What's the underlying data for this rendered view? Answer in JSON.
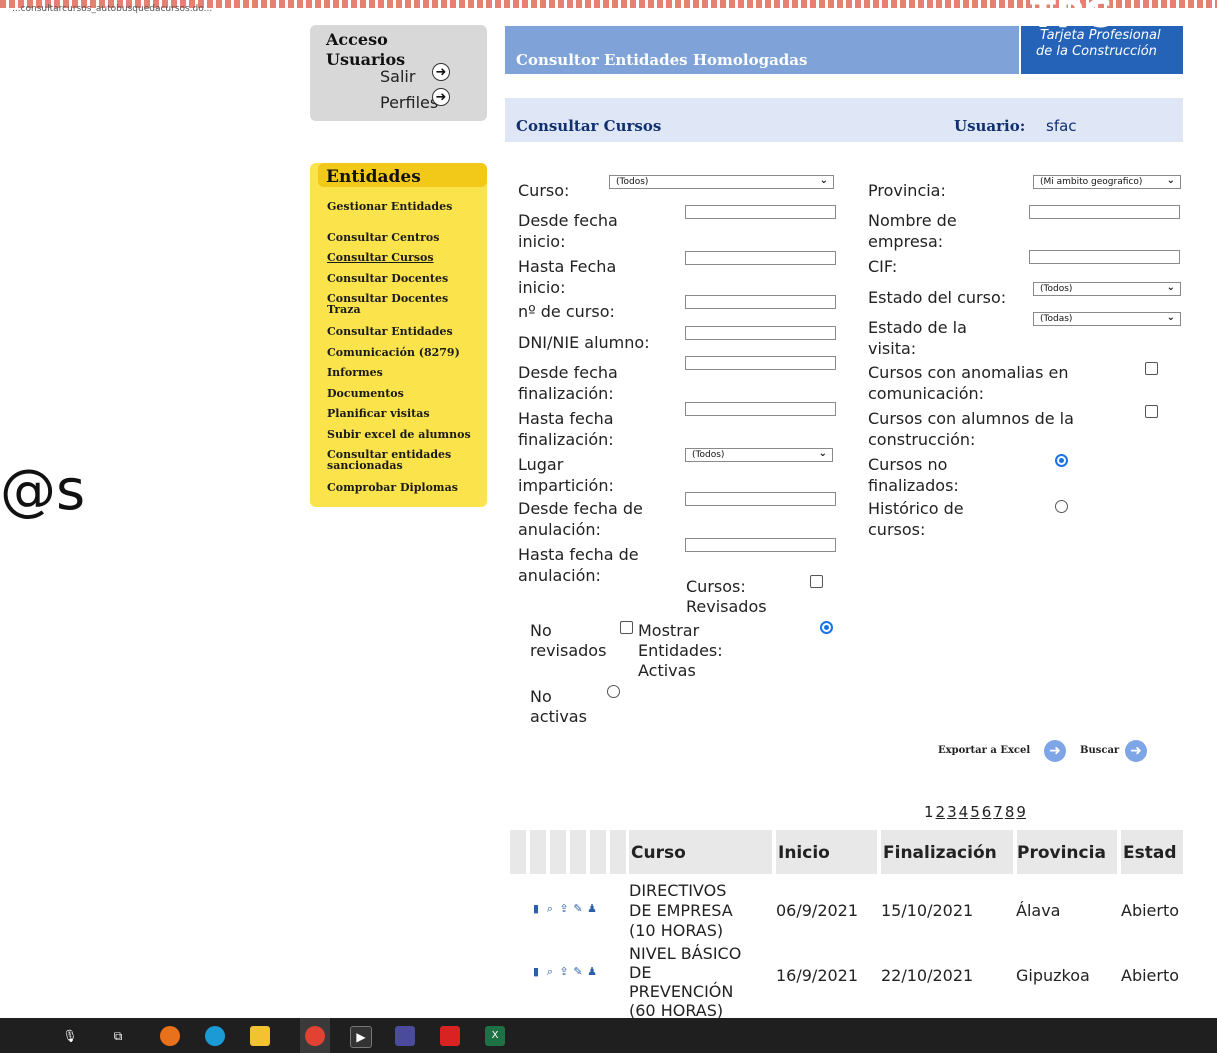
{
  "browser": {
    "url_fragment": "...consultarcursos_autobusquedacursos.do..."
  },
  "side_text": "@s",
  "access": {
    "title": "Acceso",
    "users_title": "Usuarios",
    "links": [
      {
        "label": "Salir",
        "icon": "arrow-right-circle-icon"
      },
      {
        "label": "Perfiles",
        "icon": "arrow-right-circle-icon"
      }
    ]
  },
  "entities_menu": {
    "title": "Entidades",
    "items": [
      {
        "label": "Gestionar Entidades"
      },
      {
        "label": "Consultar Centros"
      },
      {
        "label": "Consultar Cursos",
        "active": true
      },
      {
        "label": "Consultar Docentes"
      },
      {
        "label": "Consultar Docentes Traza"
      },
      {
        "label": "Consultar Entidades"
      },
      {
        "label": "Comunicación (8279)"
      },
      {
        "label": "Informes"
      },
      {
        "label": "Documentos"
      },
      {
        "label": "Planificar visitas"
      },
      {
        "label": "Subir excel de alumnos"
      },
      {
        "label": "Consultar entidades sancionadas"
      },
      {
        "label": "Comprobar Diplomas"
      }
    ]
  },
  "header": {
    "title": "Consultor Entidades Homologadas",
    "logo": {
      "big": "TPC",
      "line1": "Tarjeta Profesional",
      "line2": "de la Construcción"
    }
  },
  "subheader": {
    "title": "Consultar Cursos",
    "user_label": "Usuario:",
    "user_value": "sfac"
  },
  "form": {
    "curso": {
      "label": "Curso:",
      "value": "(Todos)"
    },
    "desde_fecha_inicio": {
      "label1": "Desde fecha",
      "label2": "inicio:",
      "value": ""
    },
    "hasta_fecha_inicio": {
      "label1": "Hasta Fecha",
      "label2": "inicio:",
      "value": ""
    },
    "num_curso": {
      "label": "nº de curso:",
      "value": ""
    },
    "dni": {
      "label": "DNI/NIE alumno:",
      "value": ""
    },
    "desde_fecha_fin": {
      "label1": "Desde fecha",
      "label2": "finalización:",
      "value": ""
    },
    "hasta_fecha_fin": {
      "label1": "Hasta fecha",
      "label2": "finalización:",
      "value": ""
    },
    "lugar": {
      "label1": "Lugar",
      "label2": "impartición:",
      "value": "(Todos)"
    },
    "desde_anul": {
      "label1": "Desde fecha de",
      "label2": "anulación:",
      "value": ""
    },
    "hasta_anul": {
      "label1": "Hasta fecha de",
      "label2": "anulación:",
      "value": ""
    },
    "revisados": {
      "label1": "Cursos:",
      "label2": "Revisados",
      "checked": false
    },
    "no_revisados": {
      "label1": "No",
      "label2": "revisados",
      "checked": false
    },
    "mostrar": {
      "label1": "Mostrar",
      "label2": "Entidades:",
      "label3": "Activas",
      "checked": true
    },
    "no_activas": {
      "label1": "No",
      "label2": "activas",
      "checked": false
    },
    "provincia": {
      "label": "Provincia:",
      "value": "(Mi ambito geografico)"
    },
    "nombre_empresa": {
      "label1": "Nombre de",
      "label2": "empresa:",
      "value": ""
    },
    "cif": {
      "label": "CIF:",
      "value": ""
    },
    "estado_curso": {
      "label": "Estado del curso:",
      "value": "(Todos)"
    },
    "estado_visita": {
      "label1": "Estado de la",
      "label2": "visita:",
      "value": "(Todas)"
    },
    "anomalias": {
      "label1": "Cursos con anomalias en",
      "label2": "comunicación:",
      "checked": false
    },
    "alumnos_construccion": {
      "label1": "Cursos con alumnos de la",
      "label2": "construcción:",
      "checked": false
    },
    "no_finalizados": {
      "label1": "Cursos no",
      "label2": "finalizados:",
      "checked": true
    },
    "historico": {
      "label1": "Histórico de",
      "label2": "cursos:",
      "checked": false
    }
  },
  "actions": {
    "export_label": "Exportar a Excel",
    "search_label": "Buscar"
  },
  "pagination": {
    "pages": [
      "1",
      "2",
      "3",
      "4",
      "5",
      "6",
      "7",
      "8",
      "9"
    ],
    "current": "1"
  },
  "table": {
    "headers": [
      "Curso",
      "Inicio",
      "Finalización",
      "Provincia",
      "Estad"
    ],
    "rows": [
      {
        "curso_lines": [
          "DIRECTIVOS",
          "DE EMPRESA",
          "(10 HORAS)"
        ],
        "inicio": "06/9/2021",
        "fin": "15/10/2021",
        "provincia": "Álava",
        "estado": "Abierto"
      },
      {
        "curso_lines": [
          "NIVEL BÁSICO",
          "DE",
          "PREVENCIÓN",
          "(60 HORAS)"
        ],
        "inicio": "16/9/2021",
        "fin": "22/10/2021",
        "provincia": "Gipuzkoa",
        "estado": "Abierto"
      }
    ]
  },
  "taskbar": {
    "icons": [
      "microphone-icon",
      "task-view-icon",
      "firefox-icon",
      "edge-icon",
      "file-explorer-icon",
      "chrome-icon",
      "terminal-icon",
      "archive-icon",
      "acrobat-icon",
      "excel-icon"
    ]
  }
}
